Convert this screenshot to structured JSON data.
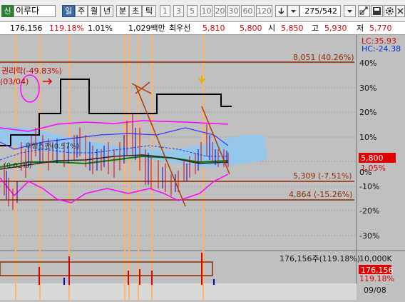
{
  "toolbar": {
    "code_badge": "신",
    "stock_name": "이루다",
    "periods": [
      "일",
      "주",
      "월",
      "년",
      "분",
      "초",
      "틱"
    ],
    "selected_period": "일",
    "intervals": [
      "1",
      "3",
      "5",
      "10",
      "20",
      "30",
      "60",
      "120"
    ],
    "page_counter": "275/542",
    "icons": [
      "down-arrow-icon",
      "dropdown-icon",
      "crosshair-icon",
      "save-icon",
      "gear-icon",
      "close-icon"
    ]
  },
  "infobar": {
    "volume": "176,156",
    "volume_ratio": "119.18%",
    "turnover": "1.01%",
    "amount": "1,029백만",
    "best_ask_label": "최우선",
    "best_ask": "5,810",
    "best_bid": "5,800",
    "open_label": "시",
    "open": "5,850",
    "high_label": "고",
    "high": "5,930",
    "low_label": "저",
    "low": "5,770"
  },
  "chart": {
    "top_right_lc": "LC:35.93",
    "top_right_hc": "HC:-24.38",
    "annotation_rights": "권리락(-49.83%)",
    "annotation_date": "(03/04)",
    "annotation_lagging": "후행스팬(0.57%)",
    "annotation_lagging2": "(0.02%)",
    "level_high": "8,051 (40.26%)",
    "level_mid": "5,309 (-7.51%)",
    "level_low": "4,864 (-15.26%)",
    "current_price": "5,800",
    "current_change": "1.05%",
    "y_ticks": [
      "40%",
      "30%",
      "20%",
      "10%",
      "0%",
      "-10%",
      "-20%",
      "-30%"
    ],
    "volume_label": "176,156주(119.18%)",
    "volume_scale": "10,000K",
    "volume_current": "176,156",
    "volume_current_pct": "119.18%",
    "date_label": "09/08",
    "colors": {
      "up": "#e00000",
      "down": "#0000d0",
      "ma5": "#0000ff",
      "ma20": "#008000",
      "envelope": "#ff00ff",
      "level": "#8b2b00",
      "cloud": "#8fc8f0",
      "highlight": "#ffb36b",
      "price_box": "#e00000"
    }
  }
}
